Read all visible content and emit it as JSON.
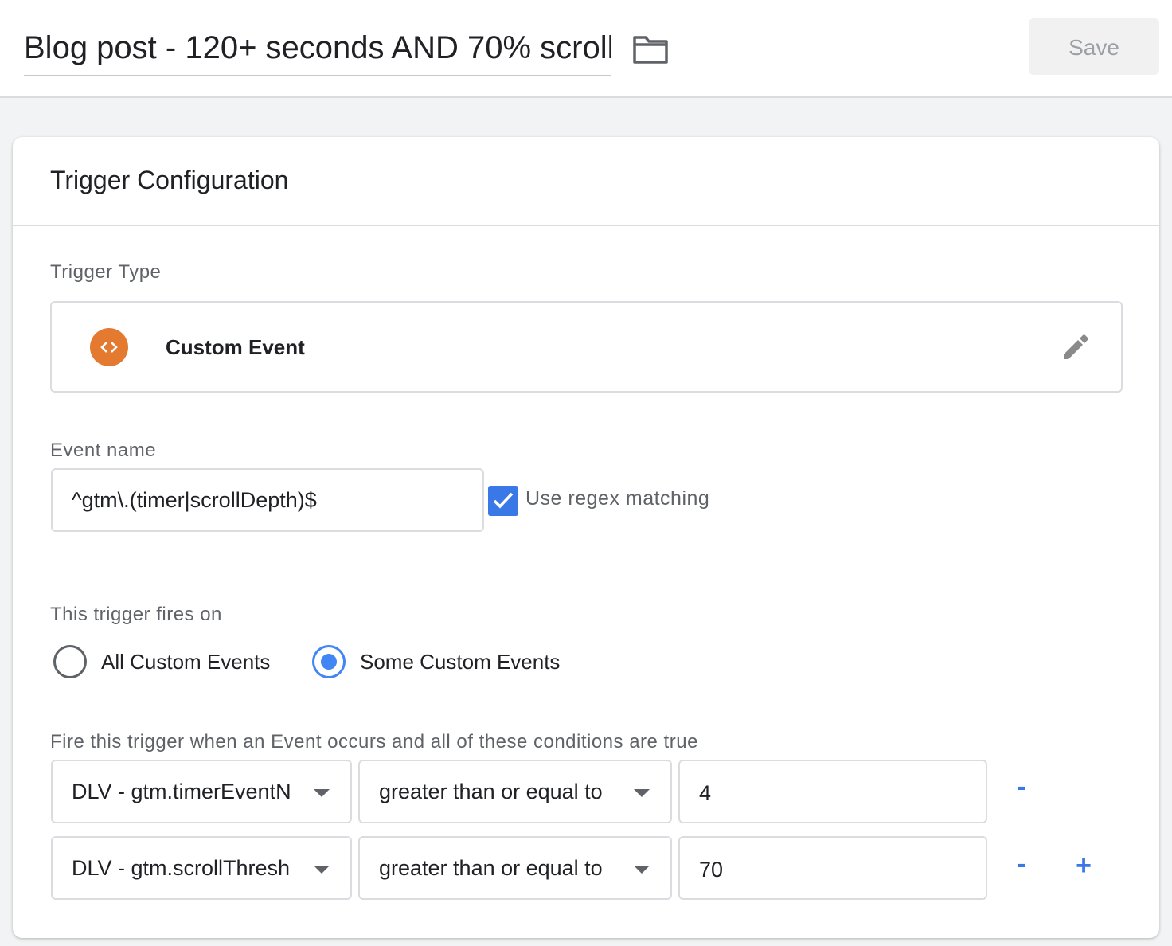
{
  "header": {
    "title": "Blog post - 120+ seconds AND 70% scroll",
    "folder_icon": "folder-icon",
    "save_label": "Save"
  },
  "card": {
    "title": "Trigger Configuration",
    "trigger_type_label": "Trigger Type",
    "trigger_type": {
      "name": "Custom Event",
      "icon": "code-brackets-icon",
      "icon_color": "#e37a2f",
      "edit_icon": "pencil-icon"
    },
    "event_name_label": "Event name",
    "event_name_value": "^gtm\\.(timer|scrollDepth)$",
    "use_regex": {
      "label": "Use regex matching",
      "checked": true
    },
    "fires_on_label": "This trigger fires on",
    "fires_on_options": [
      {
        "label": "All Custom Events",
        "selected": false
      },
      {
        "label": "Some Custom Events",
        "selected": true
      }
    ],
    "conditions_label": "Fire this trigger when an Event occurs and all of these conditions are true",
    "conditions": [
      {
        "variable": "DLV - gtm.timerEventN",
        "operator": "greater than or equal to",
        "value": "4",
        "remove": "-"
      },
      {
        "variable": "DLV - gtm.scrollThresh",
        "operator": "greater than or equal to",
        "value": "70",
        "remove": "-",
        "add": "+"
      }
    ]
  },
  "colors": {
    "accent": "#3b78e7",
    "radio_selected": "#4285f4",
    "trigger_icon": "#e37a2f"
  }
}
